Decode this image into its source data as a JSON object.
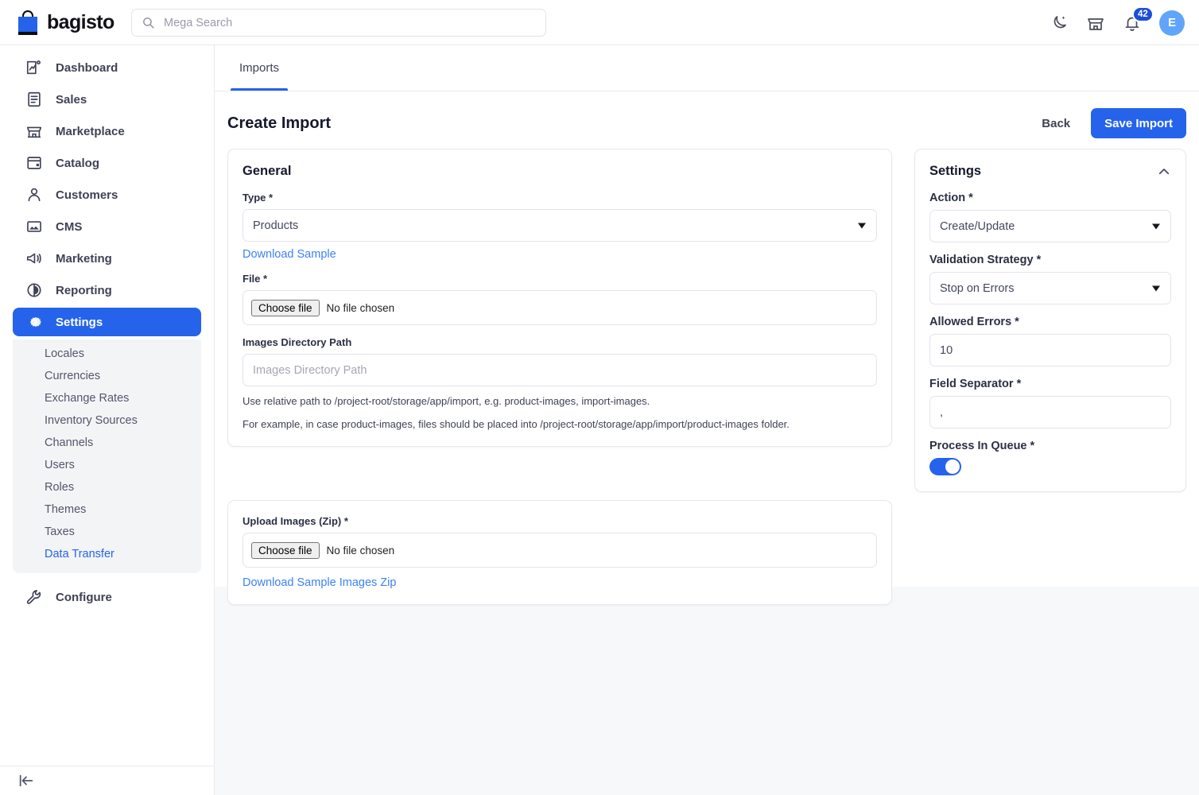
{
  "header": {
    "brand_name": "bagisto",
    "brand_icon": "shopping-bag-icon",
    "search_placeholder": "Mega Search",
    "search_value": "",
    "search_icon": "search-icon",
    "dark_mode_icon": "moon-icon",
    "store_icon": "store-icon",
    "notification_icon": "bell-icon",
    "notification_count": "42",
    "avatar_initial": "E"
  },
  "sidebar": {
    "items": [
      {
        "label": "Dashboard",
        "icon": "dashboard-icon",
        "active": false
      },
      {
        "label": "Sales",
        "icon": "sales-icon",
        "active": false
      },
      {
        "label": "Marketplace",
        "icon": "marketplace-icon",
        "active": false
      },
      {
        "label": "Catalog",
        "icon": "catalog-icon",
        "active": false
      },
      {
        "label": "Customers",
        "icon": "customers-icon",
        "active": false
      },
      {
        "label": "CMS",
        "icon": "cms-icon",
        "active": false
      },
      {
        "label": "Marketing",
        "icon": "marketing-icon",
        "active": false
      },
      {
        "label": "Reporting",
        "icon": "reporting-icon",
        "active": false
      },
      {
        "label": "Settings",
        "icon": "gear-icon",
        "active": true
      }
    ],
    "sub_items": [
      {
        "label": "Locales",
        "current": false
      },
      {
        "label": "Currencies",
        "current": false
      },
      {
        "label": "Exchange Rates",
        "current": false
      },
      {
        "label": "Inventory Sources",
        "current": false
      },
      {
        "label": "Channels",
        "current": false
      },
      {
        "label": "Users",
        "current": false
      },
      {
        "label": "Roles",
        "current": false
      },
      {
        "label": "Themes",
        "current": false
      },
      {
        "label": "Taxes",
        "current": false
      },
      {
        "label": "Data Transfer",
        "current": true
      }
    ],
    "configure": {
      "label": "Configure",
      "icon": "wrench-icon"
    },
    "collapse_icon": "collapse-sidebar-icon"
  },
  "tabs": [
    {
      "label": "Imports",
      "active": true
    }
  ],
  "page": {
    "title": "Create Import",
    "back_label": "Back",
    "save_label": "Save Import"
  },
  "general": {
    "title": "General",
    "type_label": "Type *",
    "type_value": "Products",
    "download_sample_label": "Download Sample",
    "file_label": "File *",
    "file_choose_label": "Choose file",
    "file_status": "No file chosen",
    "images_dir_label": "Images Directory Path",
    "images_dir_value": "",
    "images_dir_placeholder": "Images Directory Path",
    "hint_1": "Use relative path to /project-root/storage/app/import, e.g. product-images, import-images.",
    "hint_2": "For example, in case product-images, files should be placed into /project-root/storage/app/import/product-images folder."
  },
  "upload": {
    "label": "Upload Images (Zip) *",
    "choose_label": "Choose file",
    "status": "No file chosen",
    "download_zip_label": "Download Sample Images Zip"
  },
  "settings": {
    "title": "Settings",
    "collapse_icon": "chevron-up-icon",
    "action_label": "Action *",
    "action_value": "Create/Update",
    "validation_label": "Validation Strategy *",
    "validation_value": "Stop on Errors",
    "allowed_errors_label": "Allowed Errors *",
    "allowed_errors_value": "10",
    "field_separator_label": "Field Separator *",
    "field_separator_value": ",",
    "process_queue_label": "Process In Queue *",
    "process_queue_on": true
  },
  "colors": {
    "accent": "#2563eb",
    "badge": "#1d4ed8",
    "avatar": "#60a5fa",
    "link": "#3b82f6",
    "page_bg": "#f7f8fa",
    "submenu_bg": "#f3f4f6",
    "text": "#3f4254"
  }
}
